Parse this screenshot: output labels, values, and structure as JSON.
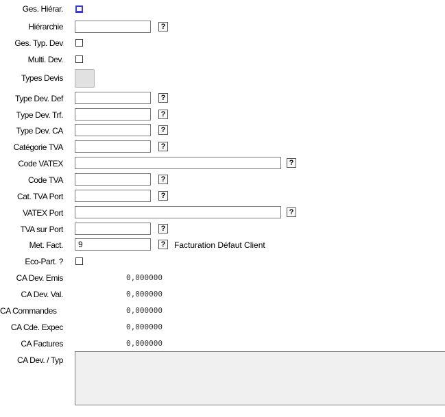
{
  "fields": {
    "ges_hierar": {
      "label": "Ges. Hiérar."
    },
    "hierarchie": {
      "label": "Hiérarchie",
      "value": ""
    },
    "ges_typ_dev": {
      "label": "Ges. Typ. Dev"
    },
    "multi_dev": {
      "label": "Multi. Dev."
    },
    "types_devis": {
      "label": "Types Devis"
    },
    "type_dev_def": {
      "label": "Type Dev. Def",
      "value": ""
    },
    "type_dev_trf": {
      "label": "Type Dev. Trf.",
      "value": ""
    },
    "type_dev_ca": {
      "label": "Type Dev. CA",
      "value": ""
    },
    "categorie_tva": {
      "label": "Catégorie TVA",
      "value": ""
    },
    "code_vatex": {
      "label": "Code VATEX",
      "value": ""
    },
    "code_tva": {
      "label": "Code TVA",
      "value": ""
    },
    "cat_tva_port": {
      "label": "Cat. TVA Port",
      "value": ""
    },
    "vatex_port": {
      "label": "VATEX Port",
      "value": ""
    },
    "tva_sur_port": {
      "label": "TVA sur Port",
      "value": ""
    },
    "met_fact": {
      "label": "Met. Fact.",
      "value": "9",
      "description": "Facturation Défaut Client"
    },
    "eco_part": {
      "label": "Eco-Part. ?"
    },
    "ca_dev_emis": {
      "label": "CA Dev. Emis",
      "value": "0,000000"
    },
    "ca_dev_val": {
      "label": "CA Dev. Val.",
      "value": "0,000000"
    },
    "ca_commandes": {
      "label": "CA Commandes",
      "value": "0,000000"
    },
    "ca_cde_expec": {
      "label": "CA Cde. Expec",
      "value": "0,000000"
    },
    "ca_factures": {
      "label": "CA Factures",
      "value": "0,000000"
    },
    "ca_dev_typ": {
      "label": "CA Dev. / Typ"
    }
  },
  "help_button_label": "?",
  "icons": {
    "help": "question-mark-icon"
  }
}
